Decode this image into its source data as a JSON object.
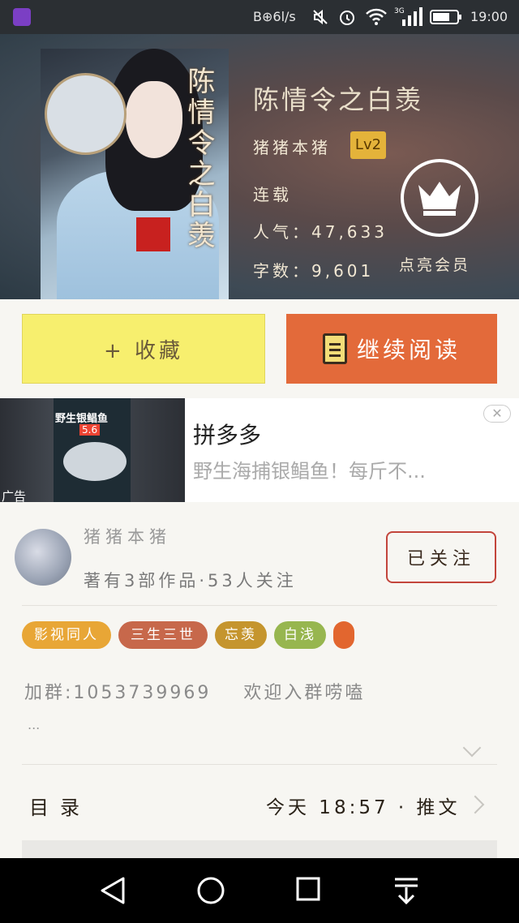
{
  "status_bar": {
    "left_text": "B⊕6l/s",
    "time": "19:00"
  },
  "book": {
    "title": "陈情令之白羡",
    "cover_title": "陈情令之白羡",
    "author": "猪猪本猪",
    "level": "Lv2",
    "status": "连载",
    "popularity": "人气：47,633",
    "word_count": "字数：9,601",
    "vip_label": "点亮会员"
  },
  "actions": {
    "collect_label": "+ 收藏",
    "read_label": "继续阅读"
  },
  "ad": {
    "image_tag": "野生银鲳鱼",
    "image_price": "5.6",
    "label": "广告",
    "title": "拼多多",
    "desc": "野生海捕银鲳鱼！每斤不..."
  },
  "author": {
    "name": "猪猪本猪",
    "info": "著有3部作品·53人关注",
    "follow_label": "已关注"
  },
  "tags": [
    {
      "label": "影视同人",
      "color": "#e8a636"
    },
    {
      "label": "三生三世",
      "color": "#c7684b"
    },
    {
      "label": "忘羡",
      "color": "#c5952e"
    },
    {
      "label": "白浅",
      "color": "#97b64f"
    },
    {
      "label": "",
      "color": "#e2662f"
    }
  ],
  "intro": {
    "text": "加群:1053739969    欢迎入群唠嗑",
    "more": "..."
  },
  "toc": {
    "label": "目录",
    "update": "今天 18:57 · 推文"
  },
  "colors": {
    "accent": "#e36a3a",
    "collect": "#f7ef6e"
  }
}
